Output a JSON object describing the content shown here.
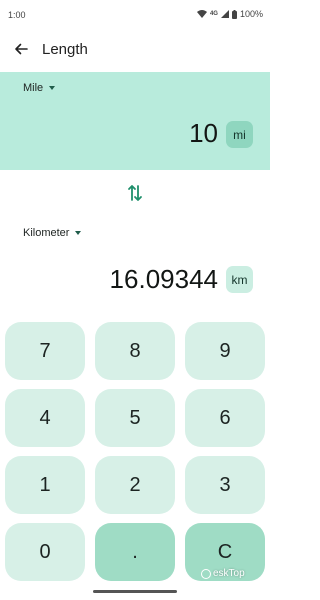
{
  "status": {
    "time": "1:00",
    "network": "4G",
    "battery": "100%"
  },
  "appbar": {
    "title": "Length"
  },
  "from": {
    "unit": "Mile",
    "value": "10",
    "abbr": "mi"
  },
  "to": {
    "unit": "Kilometer",
    "value": "16.09344",
    "abbr": "km"
  },
  "keypad": {
    "keys": [
      "7",
      "8",
      "9",
      "4",
      "5",
      "6",
      "1",
      "2",
      "3",
      "0",
      ".",
      "C"
    ]
  },
  "watermark": {
    "text": "eskTop"
  },
  "colors": {
    "panel": "#b8ebdc",
    "key": "#d7f0e7",
    "key_accent": "#9fdcc5",
    "badge": "#8fd6bf"
  }
}
